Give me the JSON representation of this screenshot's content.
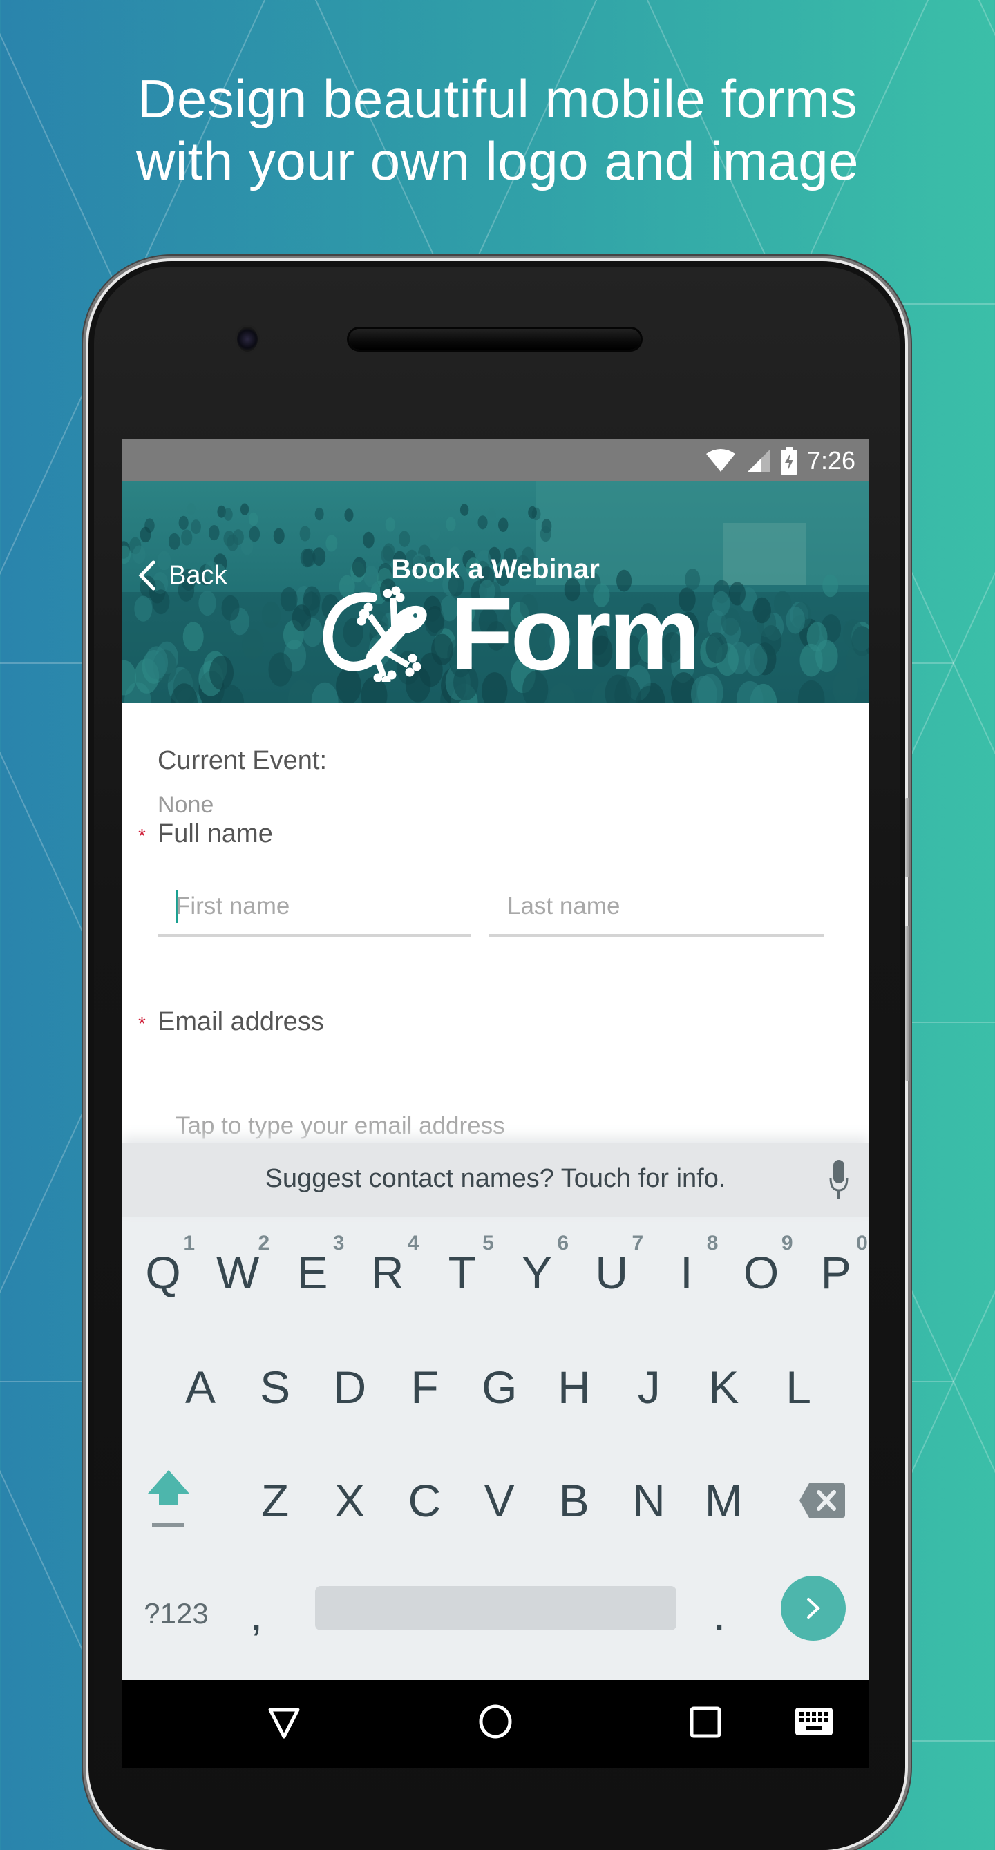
{
  "promo": {
    "headline_line1": "Design beautiful mobile forms",
    "headline_line2": "with your own logo and image"
  },
  "status_bar": {
    "time": "7:26",
    "icons": [
      "wifi-icon",
      "cell-signal-icon",
      "battery-charging-icon"
    ]
  },
  "header": {
    "back_label": "Back",
    "title": "Book a Webinar",
    "logo_text": "Form",
    "logo_icon": "gecko-icon"
  },
  "form": {
    "current_event_label": "Current Event:",
    "current_event_value": "None",
    "full_name": {
      "label": "Full name",
      "required_marker": "*",
      "first_placeholder": "First name",
      "last_placeholder": "Last name"
    },
    "email": {
      "label": "Email address",
      "required_marker": "*",
      "placeholder": "Tap to type your email address"
    },
    "submit_icon": "check-icon"
  },
  "keyboard": {
    "suggestion": "Suggest contact names? Touch for info.",
    "row1": [
      {
        "key": "Q",
        "hint": "1"
      },
      {
        "key": "W",
        "hint": "2"
      },
      {
        "key": "E",
        "hint": "3"
      },
      {
        "key": "R",
        "hint": "4"
      },
      {
        "key": "T",
        "hint": "5"
      },
      {
        "key": "Y",
        "hint": "6"
      },
      {
        "key": "U",
        "hint": "7"
      },
      {
        "key": "I",
        "hint": "8"
      },
      {
        "key": "O",
        "hint": "9"
      },
      {
        "key": "P",
        "hint": "0"
      }
    ],
    "row2": [
      "A",
      "S",
      "D",
      "F",
      "G",
      "H",
      "J",
      "K",
      "L"
    ],
    "row3": [
      "Z",
      "X",
      "C",
      "V",
      "B",
      "N",
      "M"
    ],
    "symbols_label": "?123",
    "comma": ",",
    "period": ".",
    "colors": {
      "accent": "#4db6ac",
      "key_text": "#37474f",
      "background": "#eceff1"
    }
  },
  "nav_bar": {
    "buttons": [
      "back-triangle-icon",
      "home-circle-icon",
      "recents-square-icon",
      "keyboard-switch-icon"
    ]
  },
  "colors": {
    "fab": "#0b5f66",
    "header_tint": "#1f6b6f",
    "required": "#d0203a",
    "caret": "#1aa091"
  }
}
